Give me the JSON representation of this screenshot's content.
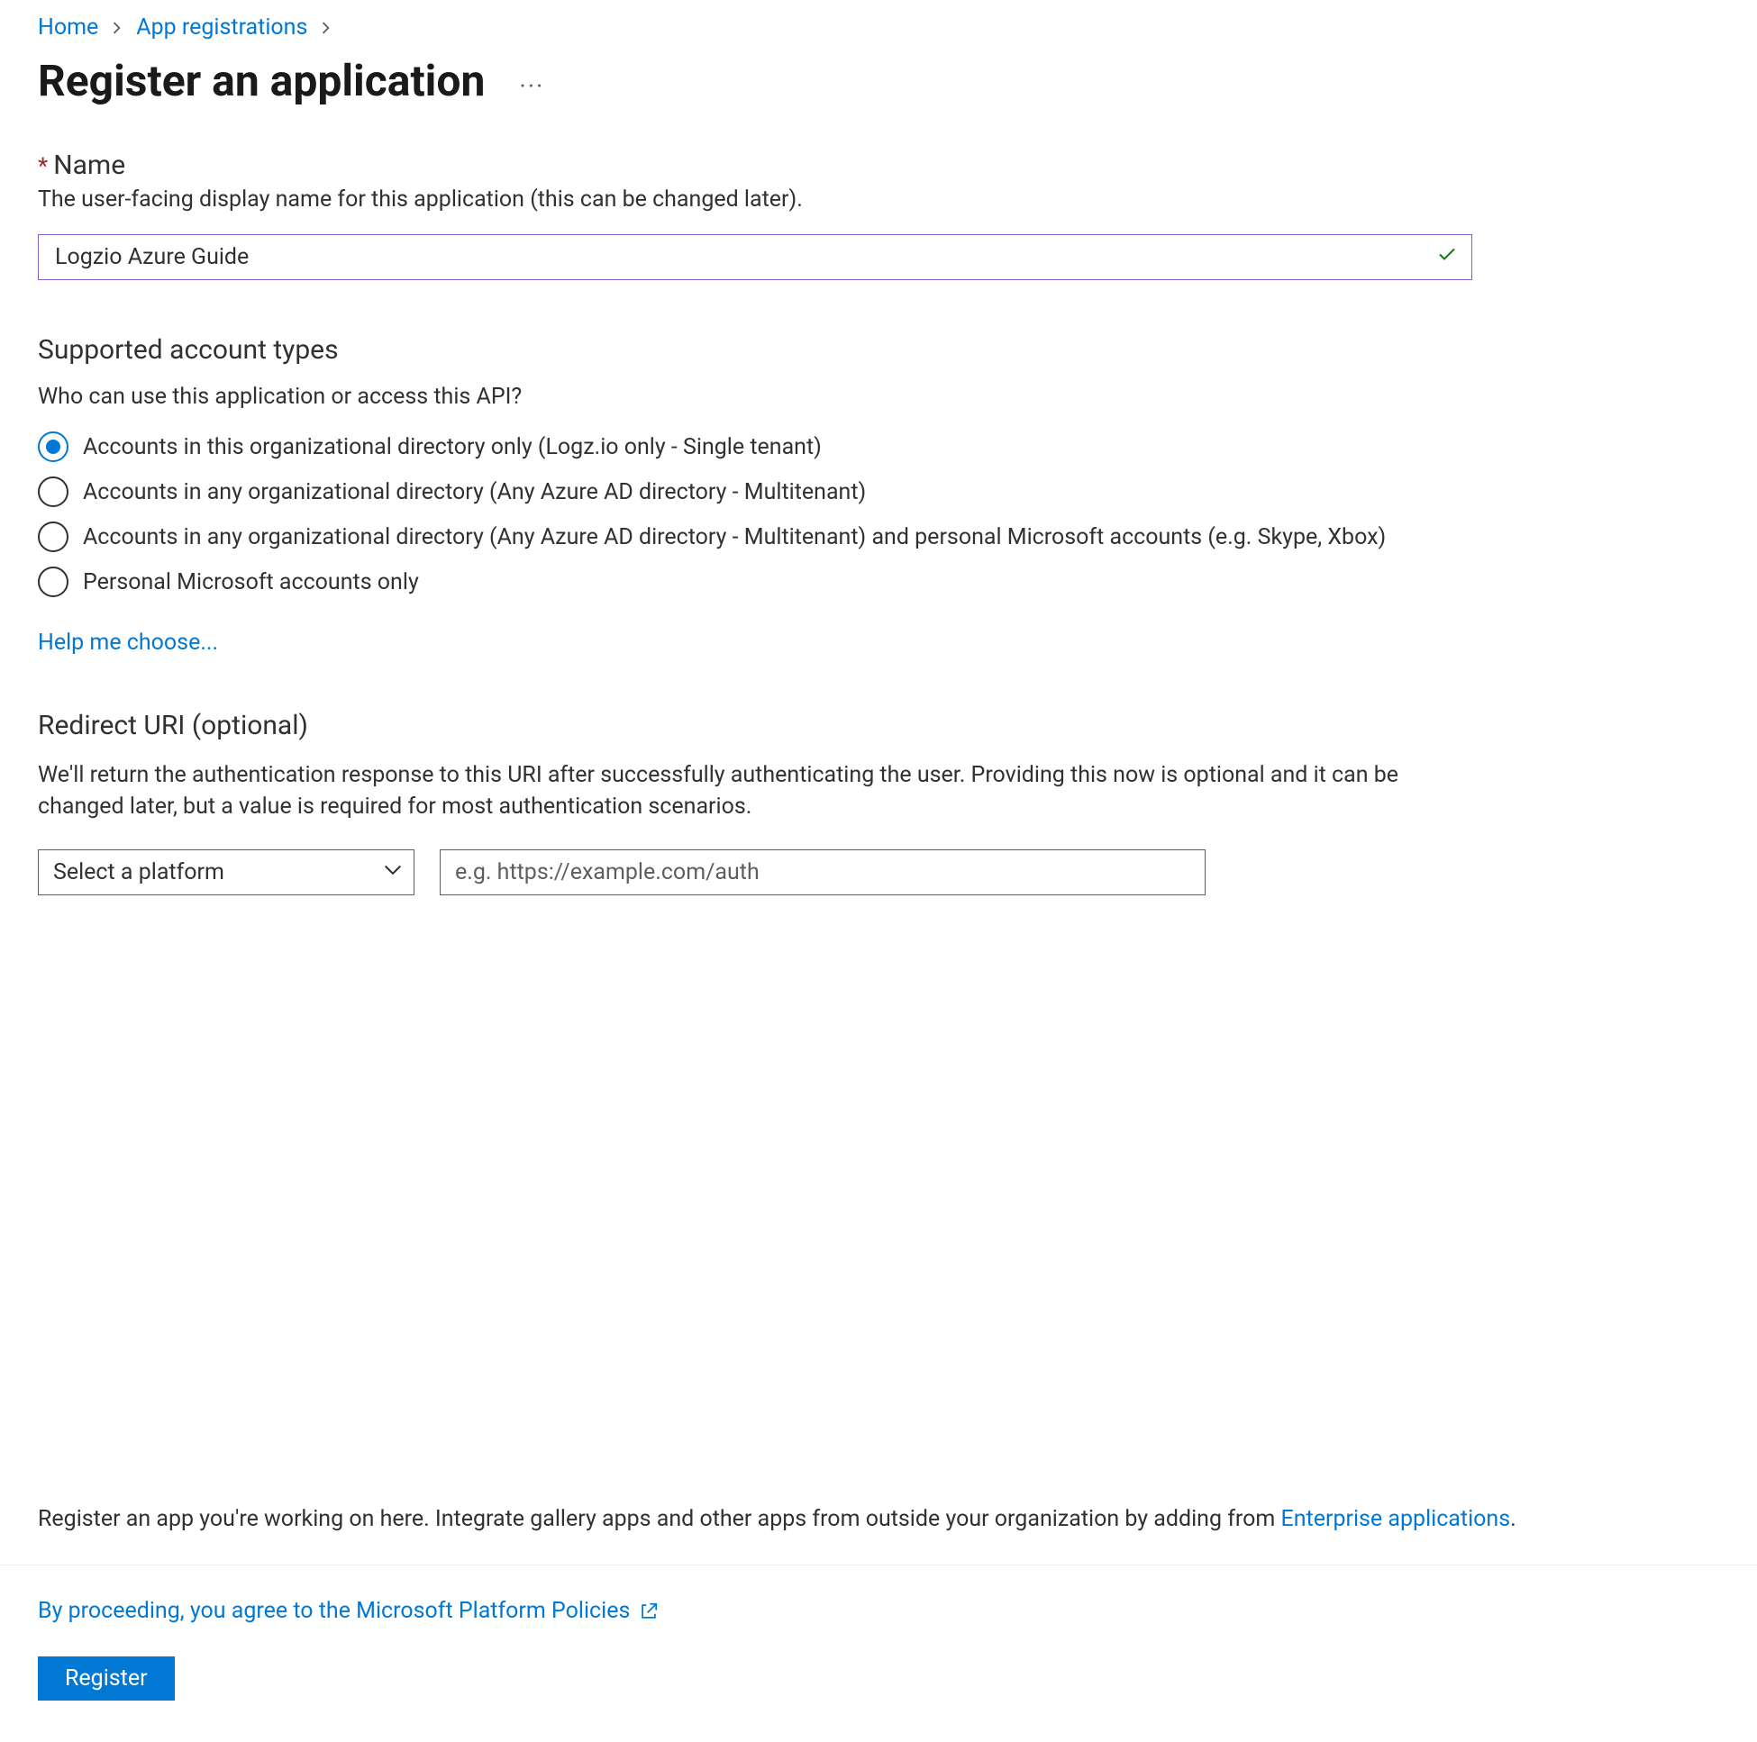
{
  "breadcrumb": {
    "items": [
      {
        "label": "Home"
      },
      {
        "label": "App registrations"
      }
    ]
  },
  "page": {
    "title": "Register an application"
  },
  "name_field": {
    "label": "Name",
    "description": "The user-facing display name for this application (this can be changed later).",
    "value": "Logzio Azure Guide"
  },
  "account_types": {
    "heading": "Supported account types",
    "question": "Who can use this application or access this API?",
    "options": [
      {
        "label": "Accounts in this organizational directory only (Logz.io only - Single tenant)",
        "selected": true
      },
      {
        "label": "Accounts in any organizational directory (Any Azure AD directory - Multitenant)",
        "selected": false
      },
      {
        "label": "Accounts in any organizational directory (Any Azure AD directory - Multitenant) and personal Microsoft accounts (e.g. Skype, Xbox)",
        "selected": false
      },
      {
        "label": "Personal Microsoft accounts only",
        "selected": false
      }
    ],
    "help_link": "Help me choose..."
  },
  "redirect": {
    "heading": "Redirect URI (optional)",
    "description": "We'll return the authentication response to this URI after successfully authenticating the user. Providing this now is optional and it can be changed later, but a value is required for most authentication scenarios.",
    "platform_placeholder": "Select a platform",
    "uri_placeholder": "e.g. https://example.com/auth"
  },
  "integrate": {
    "text_before": "Register an app you're working on here. Integrate gallery apps and other apps from outside your organization by adding from ",
    "link": "Enterprise applications",
    "text_after": "."
  },
  "footer": {
    "policies_link": "By proceeding, you agree to the Microsoft Platform Policies",
    "register_button": "Register"
  }
}
